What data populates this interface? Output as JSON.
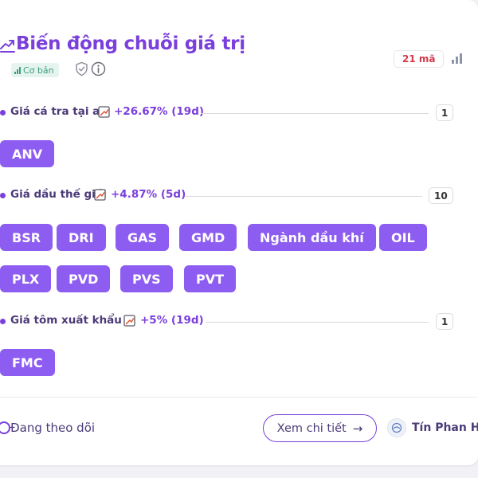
{
  "header": {
    "title": "Biến động chuỗi giá trị",
    "level_badge": "Cơ bản",
    "ticker_count": "21 mã"
  },
  "groups": [
    {
      "name": "Giá cá tra tại ao",
      "change": "+26.67% (19d)",
      "count": "1",
      "tickers": [
        "ANV"
      ]
    },
    {
      "name": "Giá dầu thế giới",
      "change": "+4.87% (5d)",
      "count": "10",
      "tickers": [
        "BSR",
        "DRI",
        "GAS",
        "GMD",
        "Ngành dầu khí",
        "OIL",
        "PLX",
        "PVD",
        "PVS",
        "PVT"
      ]
    },
    {
      "name": "Giá tôm xuất khẩu",
      "change": "+5% (19d)",
      "count": "1",
      "tickers": [
        "FMC"
      ]
    }
  ],
  "footer": {
    "follow_label": "Đang theo dõi",
    "detail_button": "Xem chi tiết",
    "detail_arrow": "→",
    "author": "Tín Phan Hu"
  },
  "colors": {
    "accent": "#7a3fdc",
    "chip": "#8d5cf0",
    "count_red": "#d23a4c",
    "badge_green": "#3d9c80",
    "background": "#f1f1f6"
  },
  "icons": {
    "title": "trending-up-icon",
    "badge": "signal-bars-icon",
    "verify": "shield-check-icon",
    "info": "info-icon",
    "stats": "bar-chart-icon",
    "group_status": "chart-check-icon",
    "follow": "follow-dot-icon",
    "avatar": "author-avatar-icon"
  }
}
